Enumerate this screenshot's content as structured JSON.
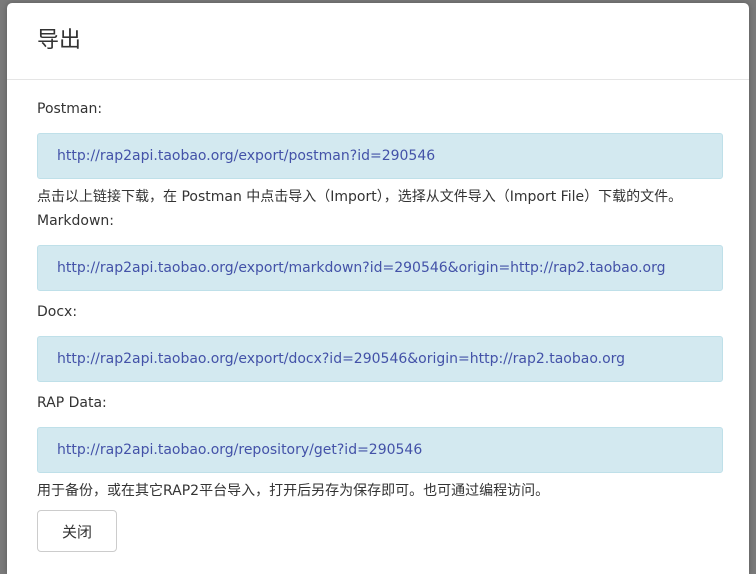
{
  "dialog": {
    "title": "导出",
    "sections": [
      {
        "label": "Postman:",
        "url": "http://rap2api.taobao.org/export/postman?id=290546",
        "note": "点击以上链接下载，在 Postman 中点击导入（Import），选择从文件导入（Import File）下载的文件。"
      },
      {
        "label": "Markdown:",
        "url": "http://rap2api.taobao.org/export/markdown?id=290546&origin=http://rap2.taobao.org"
      },
      {
        "label": "Docx:",
        "url": "http://rap2api.taobao.org/export/docx?id=290546&origin=http://rap2.taobao.org"
      },
      {
        "label": "RAP Data:",
        "url": "http://rap2api.taobao.org/repository/get?id=290546",
        "note": "用于备份，或在其它RAP2平台导入，打开后另存为保存即可。也可通过编程访问。"
      }
    ],
    "close_label": "关闭"
  },
  "colors": {
    "link": "#4352a8",
    "link_box_bg": "#d3e9f0",
    "overlay": "#7a7a7a"
  }
}
